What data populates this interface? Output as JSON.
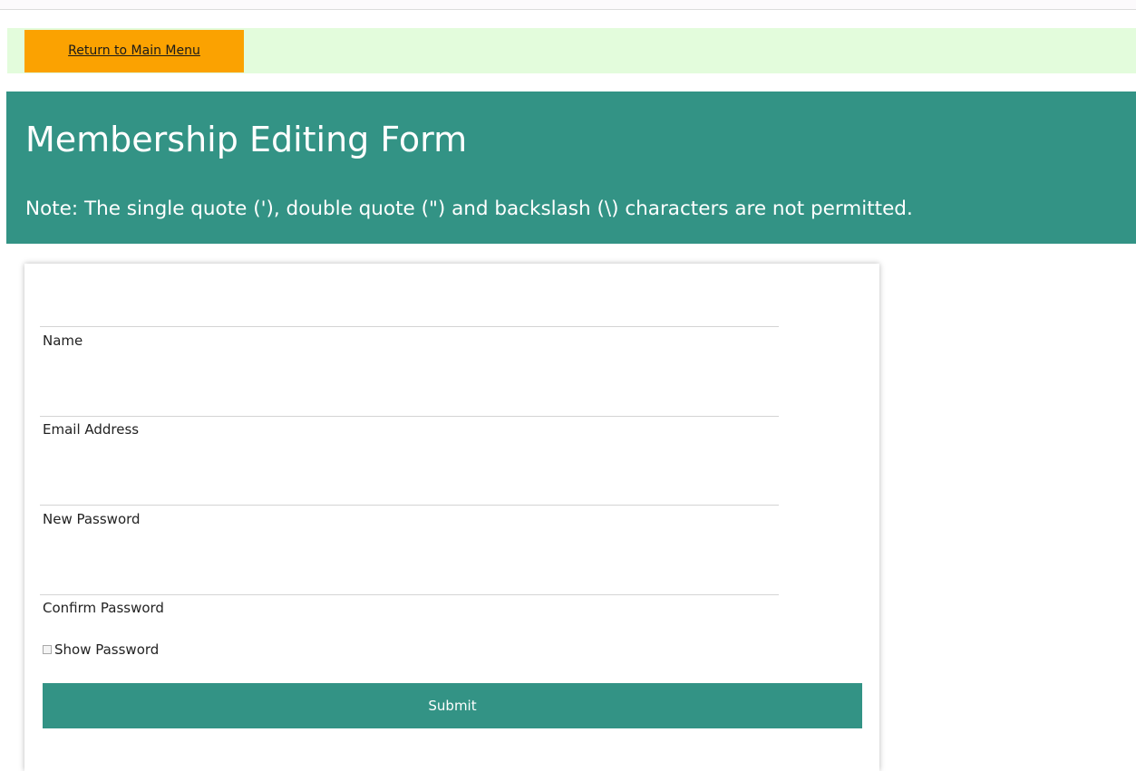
{
  "nav": {
    "return_label": "Return to Main Menu"
  },
  "header": {
    "title": "Membership Editing Form",
    "note": "Note: The single quote ('), double quote (\") and backslash (\\) characters are not permitted."
  },
  "form": {
    "fields": [
      {
        "label": "Name",
        "value": ""
      },
      {
        "label": "Email Address",
        "value": ""
      },
      {
        "label": "New Password",
        "value": ""
      },
      {
        "label": "Confirm Password",
        "value": ""
      }
    ],
    "show_password_label": "Show Password",
    "show_password_checked": false,
    "submit_label": "Submit"
  },
  "colors": {
    "accent": "#339385",
    "nav_bar": "#e3fcdc",
    "return_button": "#fba201"
  }
}
